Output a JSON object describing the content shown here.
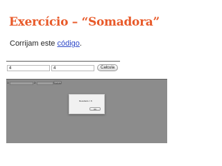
{
  "slide": {
    "title": "Exercício – “Somadora”",
    "subtitle_before": "Corrijam este ",
    "subtitle_link": "código",
    "subtitle_after": "."
  },
  "form": {
    "input_a_value": "4",
    "input_b_value": "4",
    "button_label": "Calcula"
  },
  "browser_screenshot": {
    "field_a_label": "1:",
    "field_b_label": "2:",
    "button_label": "Calcule",
    "alert": {
      "message": "Resultado = 8",
      "ok_label": "OK"
    }
  },
  "colors": {
    "title": "#e85a2a",
    "link": "#2b46c8",
    "overlay": "#8c8c8c"
  }
}
